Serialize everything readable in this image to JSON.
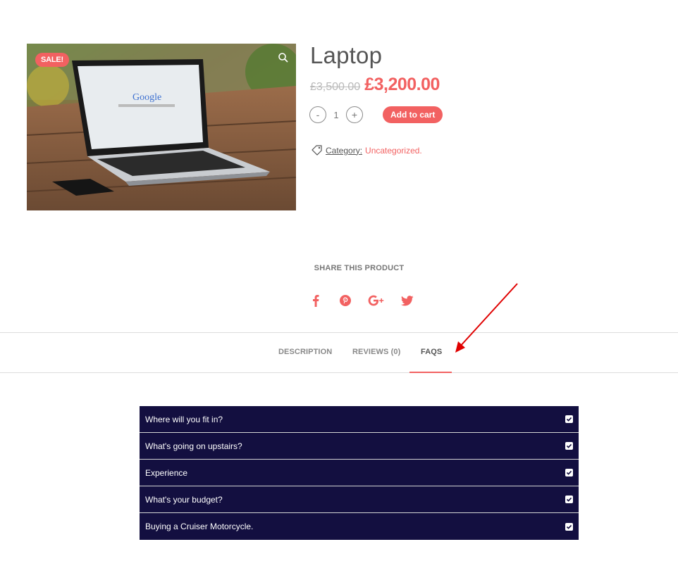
{
  "product": {
    "title": "Laptop",
    "sale_badge": "SALE!",
    "price_old": "£3,500.00",
    "price_new": "£3,200.00",
    "quantity": "1",
    "qty_minus": "-",
    "qty_plus": "+",
    "add_to_cart_label": "Add to cart",
    "category_label": "Category:",
    "category_value": "Uncategorized",
    "category_suffix": "."
  },
  "share": {
    "title": "SHARE THIS PRODUCT",
    "icons": [
      "facebook-icon",
      "pinterest-icon",
      "google-plus-icon",
      "twitter-icon"
    ]
  },
  "tabs": [
    {
      "label": "DESCRIPTION",
      "active": false
    },
    {
      "label": "REVIEWS (0)",
      "active": false
    },
    {
      "label": "FAQS",
      "active": true
    }
  ],
  "faqs": [
    {
      "question": "Where will you fit in?"
    },
    {
      "question": "What's going on upstairs?"
    },
    {
      "question": "Experience"
    },
    {
      "question": "What's your budget?"
    },
    {
      "question": "Buying a Cruiser Motorcycle."
    }
  ],
  "colors": {
    "accent": "#f26161",
    "faq_bg": "#130f40",
    "annotation_arrow": "#e00000"
  }
}
